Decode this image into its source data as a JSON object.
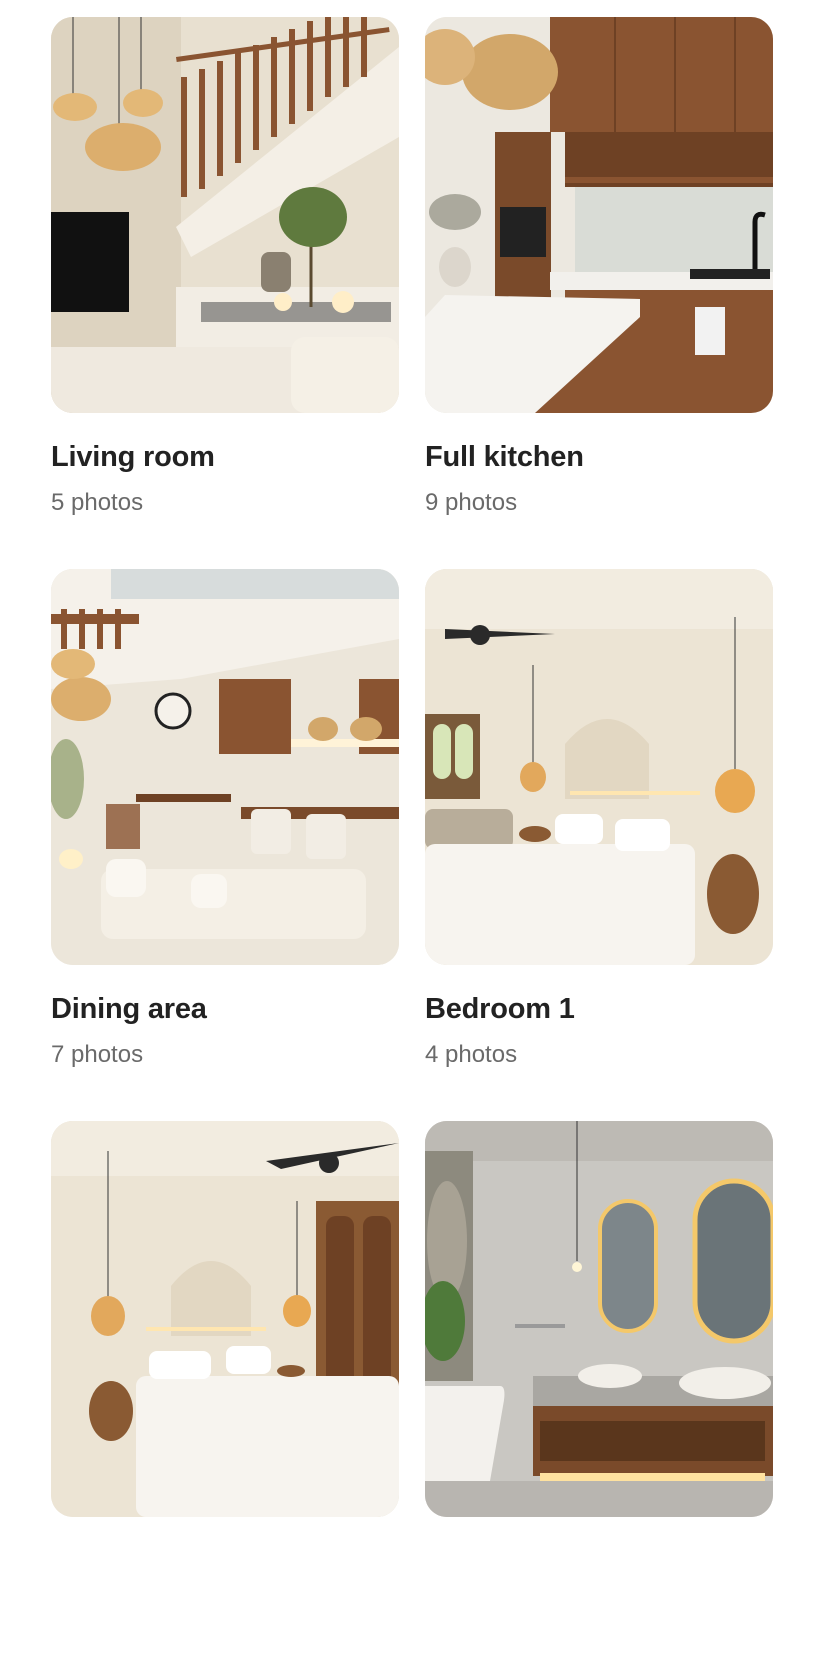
{
  "gallery": {
    "rooms": [
      {
        "title": "Living room",
        "count": "5 photos"
      },
      {
        "title": "Full kitchen",
        "count": "9 photos"
      },
      {
        "title": "Dining area",
        "count": "7 photos"
      },
      {
        "title": "Bedroom 1",
        "count": "4 photos"
      },
      {
        "title": "",
        "count": ""
      },
      {
        "title": "",
        "count": ""
      }
    ]
  }
}
